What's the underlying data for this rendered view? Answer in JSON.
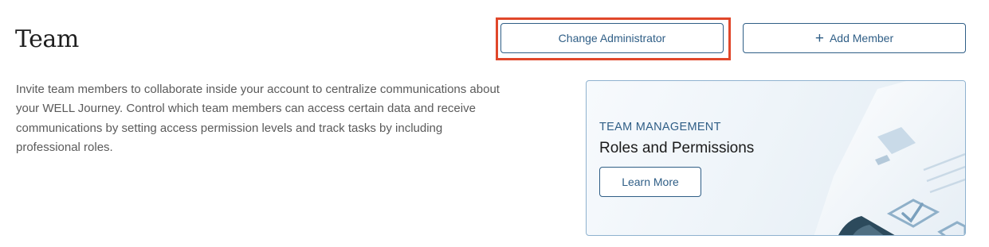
{
  "header": {
    "title": "Team",
    "change_admin_label": "Change Administrator",
    "add_member_label": "Add Member",
    "add_member_icon": "plus-icon"
  },
  "description": "Invite team members to collaborate inside your account to centralize communications about your WELL Journey. Control which team members can access certain data and receive communications by setting access permission levels and track tasks by including professional roles.",
  "promo": {
    "eyebrow": "TEAM MANAGEMENT",
    "heading": "Roles and Permissions",
    "button_label": "Learn More",
    "illustration": "checklist-icon"
  },
  "colors": {
    "accent": "#2f5e86",
    "highlight": "#e0472a",
    "card_border": "#8fb2cf"
  }
}
